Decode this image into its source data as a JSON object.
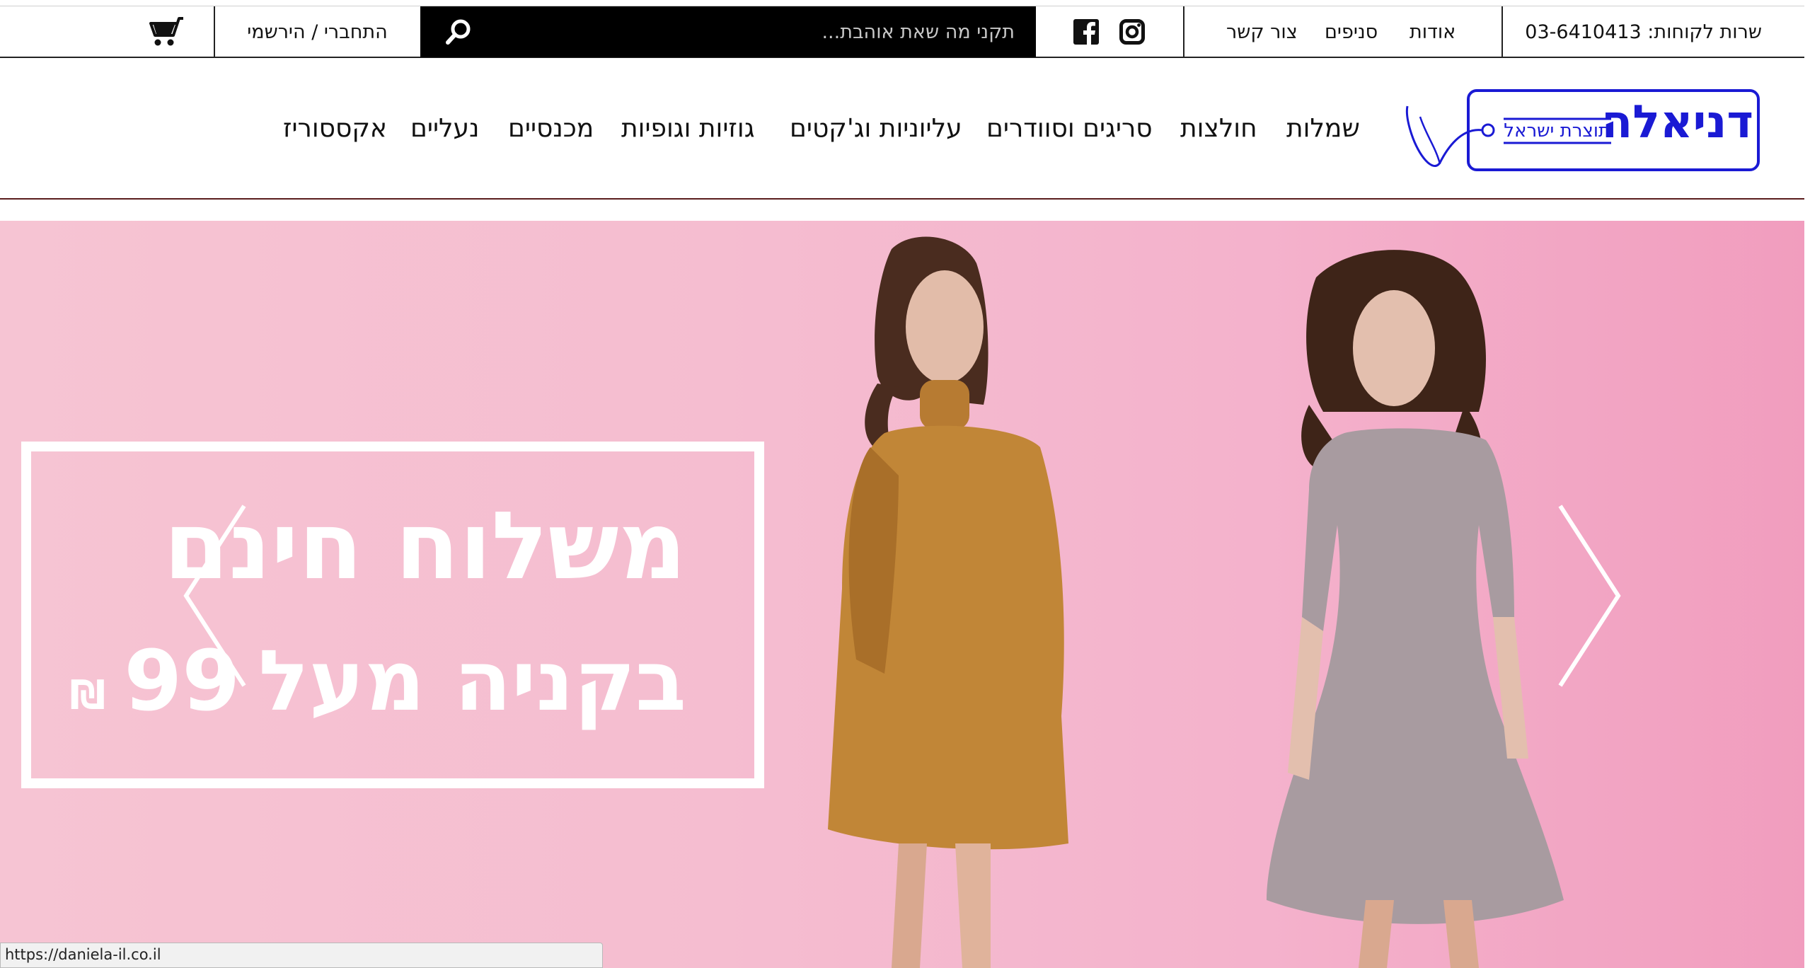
{
  "topbar": {
    "customer_service": "שרות לקוחות: 03-6410413",
    "links": [
      {
        "label": "אודות"
      },
      {
        "label": "סניפים"
      },
      {
        "label": "צור קשר"
      }
    ],
    "search_placeholder": "תקני מה שאת אוהבת...",
    "login_label": "התחברי / הירשמי",
    "icons": [
      "instagram-icon",
      "facebook-icon",
      "search-icon",
      "cart-icon"
    ]
  },
  "logo": {
    "brand": "דניאלה",
    "tagline": "תוצרת ישראל",
    "color": "#1a1ad4"
  },
  "nav": {
    "items": [
      {
        "label": "שמלות"
      },
      {
        "label": "חולצות"
      },
      {
        "label": "סריגים וסוודרים"
      },
      {
        "label": "עליוניות וג'קטים"
      },
      {
        "label": "גוזיות וגופיות"
      },
      {
        "label": "מכנסיים"
      },
      {
        "label": "נעליים"
      },
      {
        "label": "אקססוריז"
      }
    ]
  },
  "hero": {
    "promo_line1": "משלוח חינם",
    "promo_line2": "בקניה מעל",
    "promo_amount": "99",
    "currency_symbol": "₪",
    "background_color": "#f5bdd0"
  },
  "statusbar": {
    "url": "https://daniela-il.co.il"
  }
}
